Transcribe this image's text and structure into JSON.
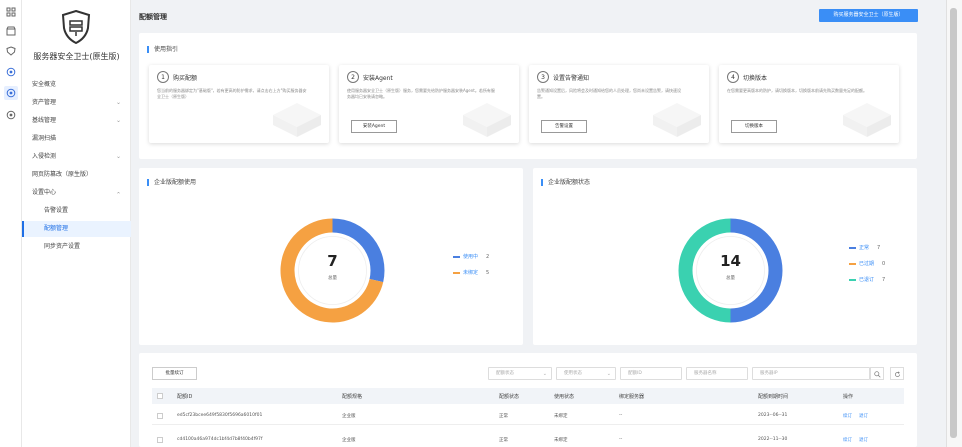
{
  "rail": {
    "icons": [
      "grid-icon",
      "store-icon",
      "shield-icon",
      "server-shield-icon",
      "active-security-icon",
      "settings-icon"
    ]
  },
  "sidebar": {
    "product_name": "服务器安全卫士(原生版)",
    "items": [
      {
        "label": "安全概览",
        "chevron": ""
      },
      {
        "label": "资产管理",
        "chevron": "⌄"
      },
      {
        "label": "基线管理",
        "chevron": "⌄"
      },
      {
        "label": "漏洞扫描",
        "chevron": ""
      },
      {
        "label": "入侵检测",
        "chevron": "⌄"
      },
      {
        "label": "网页防篡改（原生版）",
        "chevron": ""
      },
      {
        "label": "设置中心",
        "chevron": "⌄"
      }
    ],
    "sub_items": [
      {
        "label": "告警设置"
      },
      {
        "label": "配额管理"
      },
      {
        "label": "同步资产设置"
      }
    ]
  },
  "header": {
    "title": "配额管理",
    "buy_button": "购买服务器安全卫士（原生版）"
  },
  "guide": {
    "title": "使用指引",
    "steps": [
      {
        "num": "1",
        "title": "购买配额",
        "desc": "您当前的服务器绑定为\"基础版\"，若有更高的防护需求，请点击右上方\"购买服务器安全卫士（原生版）",
        "button": ""
      },
      {
        "num": "2",
        "title": "安装Agent",
        "desc": "使用服务器安全卫士（原生版）服务，您需要先给防护服务器安装Agent。若所有服务器均已安装请忽略。",
        "button": "安装Agent"
      },
      {
        "num": "3",
        "title": "设置告警通知",
        "desc": "告警通知设置后，风险将会及时通知给您的人员处理，您尚未设置告警，请快速设置。",
        "button": "告警设置"
      },
      {
        "num": "4",
        "title": "切换版本",
        "desc": "在您需要更高版本的防护，请切换版本，切换版本前请先购买数量充足的配额。",
        "button": "切换版本"
      }
    ]
  },
  "usage_card": {
    "title": "企业版配额使用",
    "total": "7",
    "total_label": "总量",
    "legend": [
      {
        "label": "使用中",
        "value": "2",
        "color": "#4a7fe0"
      },
      {
        "label": "未绑定",
        "value": "5",
        "color": "#f5a142"
      }
    ]
  },
  "status_card": {
    "title": "企业版配额状态",
    "total": "14",
    "total_label": "总量",
    "legend": [
      {
        "label": "正常",
        "value": "7",
        "color": "#4a7fe0"
      },
      {
        "label": "已过期",
        "value": "0",
        "color": "#f5a142"
      },
      {
        "label": "已退订",
        "value": "7",
        "color": "#3ad1b0"
      }
    ]
  },
  "chart_data": [
    {
      "type": "pie",
      "title": "企业版配额使用",
      "categories": [
        "使用中",
        "未绑定"
      ],
      "values": [
        2,
        5
      ],
      "colors": [
        "#4a7fe0",
        "#f5a142"
      ],
      "center_value": "7",
      "center_label": "总量"
    },
    {
      "type": "pie",
      "title": "企业版配额状态",
      "categories": [
        "正常",
        "已过期",
        "已退订"
      ],
      "values": [
        7,
        0,
        7
      ],
      "colors": [
        "#4a7fe0",
        "#f5a142",
        "#3ad1b0"
      ],
      "center_value": "14",
      "center_label": "总量"
    }
  ],
  "table": {
    "bulk_button": "批量续订",
    "filters": {
      "quota_status": "配额状态",
      "usage_status": "使用状态",
      "quota_id": "配额ID",
      "server_name": "服务器名称",
      "server_ip": "服务器IP"
    },
    "columns": [
      "配额ID",
      "配额规格",
      "配额状态",
      "使用状态",
      "绑定服务器",
      "配额到期时间",
      "操作"
    ],
    "rows": [
      {
        "id": "ed5cf23bcee649f5830f5696a6010f01",
        "spec": "企业版",
        "status": "正常",
        "usage": "未绑定",
        "server": "--",
        "expiry": "2023--06--31",
        "renew": "续订",
        "unsub": "退订"
      },
      {
        "id": "cd4100a46a974dc1bf4d7b8f40b4f97f",
        "spec": "企业版",
        "status": "正常",
        "usage": "未绑定",
        "server": "--",
        "expiry": "2022--11--30",
        "renew": "续订",
        "unsub": "退订"
      }
    ]
  }
}
